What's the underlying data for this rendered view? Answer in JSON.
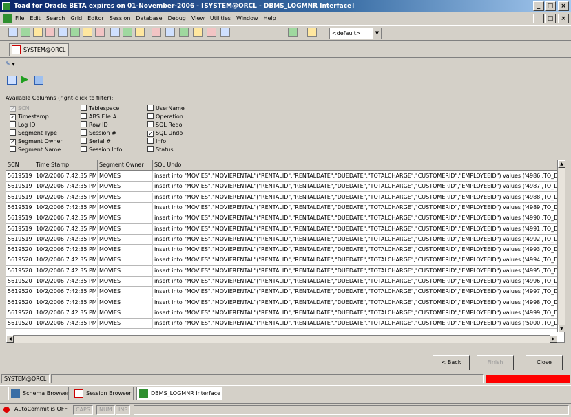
{
  "window": {
    "title": "Toad for Oracle BETA expires on 01-November-2006 - [SYSTEM@ORCL - DBMS_LOGMNR Interface]",
    "controls": [
      "_",
      "̄",
      "×"
    ],
    "mdi_controls": [
      "_",
      "̄",
      "×"
    ]
  },
  "menu": [
    "File",
    "Edit",
    "Search",
    "Grid",
    "Editor",
    "Session",
    "Database",
    "Debug",
    "View",
    "Utilities",
    "Window",
    "Help"
  ],
  "toolbar": {
    "combo_value": "<default>"
  },
  "connection_tab": "SYSTEM@ORCL",
  "columns_section": {
    "caption": "Available Columns (right-click to filter):",
    "col1": [
      {
        "label": "SCN",
        "checked": true,
        "disabled": true
      },
      {
        "label": "Timestamp",
        "checked": true
      },
      {
        "label": "Log ID",
        "checked": false
      },
      {
        "label": "Segment Type",
        "checked": false
      },
      {
        "label": "Segment Owner",
        "checked": true
      },
      {
        "label": "Segment Name",
        "checked": false
      }
    ],
    "col2": [
      {
        "label": "Tablespace",
        "checked": false
      },
      {
        "label": "ABS File #",
        "checked": false
      },
      {
        "label": "Row ID",
        "checked": false
      },
      {
        "label": "Session #",
        "checked": false
      },
      {
        "label": "Serial #",
        "checked": false
      },
      {
        "label": "Session Info",
        "checked": false
      }
    ],
    "col3": [
      {
        "label": "UserName",
        "checked": false
      },
      {
        "label": "Operation",
        "checked": false
      },
      {
        "label": "SQL Redo",
        "checked": false
      },
      {
        "label": "SQL Undo",
        "checked": true
      },
      {
        "label": "Info",
        "checked": false
      },
      {
        "label": "Status",
        "checked": false
      }
    ]
  },
  "grid": {
    "headers": [
      "SCN",
      "Time Stamp",
      "Segment Owner",
      "SQL Undo"
    ],
    "rows": [
      [
        "5619519",
        "10/2/2006 7:42:35 PM",
        "MOVIES",
        "insert into \"MOVIES\".\"MOVIERENTAL\"(\"RENTALID\",\"RENTALDATE\",\"DUEDATE\",\"TOTALCHARGE\",\"CUSTOMERID\",\"EMPLOYEEID\") values ('4986',TO_DAT"
      ],
      [
        "5619519",
        "10/2/2006 7:42:35 PM",
        "MOVIES",
        "insert into \"MOVIES\".\"MOVIERENTAL\"(\"RENTALID\",\"RENTALDATE\",\"DUEDATE\",\"TOTALCHARGE\",\"CUSTOMERID\",\"EMPLOYEEID\") values ('4987',TO_DAT"
      ],
      [
        "5619519",
        "10/2/2006 7:42:35 PM",
        "MOVIES",
        "insert into \"MOVIES\".\"MOVIERENTAL\"(\"RENTALID\",\"RENTALDATE\",\"DUEDATE\",\"TOTALCHARGE\",\"CUSTOMERID\",\"EMPLOYEEID\") values ('4988',TO_DAT"
      ],
      [
        "5619519",
        "10/2/2006 7:42:35 PM",
        "MOVIES",
        "insert into \"MOVIES\".\"MOVIERENTAL\"(\"RENTALID\",\"RENTALDATE\",\"DUEDATE\",\"TOTALCHARGE\",\"CUSTOMERID\",\"EMPLOYEEID\") values ('4989',TO_DAT"
      ],
      [
        "5619519",
        "10/2/2006 7:42:35 PM",
        "MOVIES",
        "insert into \"MOVIES\".\"MOVIERENTAL\"(\"RENTALID\",\"RENTALDATE\",\"DUEDATE\",\"TOTALCHARGE\",\"CUSTOMERID\",\"EMPLOYEEID\") values ('4990',TO_DAT"
      ],
      [
        "5619519",
        "10/2/2006 7:42:35 PM",
        "MOVIES",
        "insert into \"MOVIES\".\"MOVIERENTAL\"(\"RENTALID\",\"RENTALDATE\",\"DUEDATE\",\"TOTALCHARGE\",\"CUSTOMERID\",\"EMPLOYEEID\") values ('4991',TO_DAT"
      ],
      [
        "5619519",
        "10/2/2006 7:42:35 PM",
        "MOVIES",
        "insert into \"MOVIES\".\"MOVIERENTAL\"(\"RENTALID\",\"RENTALDATE\",\"DUEDATE\",\"TOTALCHARGE\",\"CUSTOMERID\",\"EMPLOYEEID\") values ('4992',TO_DAT"
      ],
      [
        "5619520",
        "10/2/2006 7:42:35 PM",
        "MOVIES",
        "insert into \"MOVIES\".\"MOVIERENTAL\"(\"RENTALID\",\"RENTALDATE\",\"DUEDATE\",\"TOTALCHARGE\",\"CUSTOMERID\",\"EMPLOYEEID\") values ('4993',TO_DAT"
      ],
      [
        "5619520",
        "10/2/2006 7:42:35 PM",
        "MOVIES",
        "insert into \"MOVIES\".\"MOVIERENTAL\"(\"RENTALID\",\"RENTALDATE\",\"DUEDATE\",\"TOTALCHARGE\",\"CUSTOMERID\",\"EMPLOYEEID\") values ('4994',TO_DAT"
      ],
      [
        "5619520",
        "10/2/2006 7:42:35 PM",
        "MOVIES",
        "insert into \"MOVIES\".\"MOVIERENTAL\"(\"RENTALID\",\"RENTALDATE\",\"DUEDATE\",\"TOTALCHARGE\",\"CUSTOMERID\",\"EMPLOYEEID\") values ('4995',TO_DAT"
      ],
      [
        "5619520",
        "10/2/2006 7:42:35 PM",
        "MOVIES",
        "insert into \"MOVIES\".\"MOVIERENTAL\"(\"RENTALID\",\"RENTALDATE\",\"DUEDATE\",\"TOTALCHARGE\",\"CUSTOMERID\",\"EMPLOYEEID\") values ('4996',TO_DAT"
      ],
      [
        "5619520",
        "10/2/2006 7:42:35 PM",
        "MOVIES",
        "insert into \"MOVIES\".\"MOVIERENTAL\"(\"RENTALID\",\"RENTALDATE\",\"DUEDATE\",\"TOTALCHARGE\",\"CUSTOMERID\",\"EMPLOYEEID\") values ('4997',TO_DAT"
      ],
      [
        "5619520",
        "10/2/2006 7:42:35 PM",
        "MOVIES",
        "insert into \"MOVIES\".\"MOVIERENTAL\"(\"RENTALID\",\"RENTALDATE\",\"DUEDATE\",\"TOTALCHARGE\",\"CUSTOMERID\",\"EMPLOYEEID\") values ('4998',TO_DAT"
      ],
      [
        "5619520",
        "10/2/2006 7:42:35 PM",
        "MOVIES",
        "insert into \"MOVIES\".\"MOVIERENTAL\"(\"RENTALID\",\"RENTALDATE\",\"DUEDATE\",\"TOTALCHARGE\",\"CUSTOMERID\",\"EMPLOYEEID\") values ('4999',TO_DAT"
      ],
      [
        "5619520",
        "10/2/2006 7:42:35 PM",
        "MOVIES",
        "insert into \"MOVIES\".\"MOVIERENTAL\"(\"RENTALID\",\"RENTALDATE\",\"DUEDATE\",\"TOTALCHARGE\",\"CUSTOMERID\",\"EMPLOYEEID\") values ('5000',TO_DAT"
      ]
    ]
  },
  "buttons": {
    "back": "< Back",
    "finish": "Finish",
    "close": "Close"
  },
  "status_connection": "SYSTEM@ORCL",
  "tasks": [
    "Schema Browser",
    "Session Browser",
    "DBMS_LOGMNR Interface"
  ],
  "status_bottom": {
    "autocommit": "AutoCommit is OFF",
    "caps": "CAPS",
    "num": "NUM",
    "ins": "INS"
  },
  "colors": {
    "title_start": "#0a246a",
    "title_end": "#a6caf0",
    "alert": "#ff0000",
    "face": "#d4d0c8"
  }
}
